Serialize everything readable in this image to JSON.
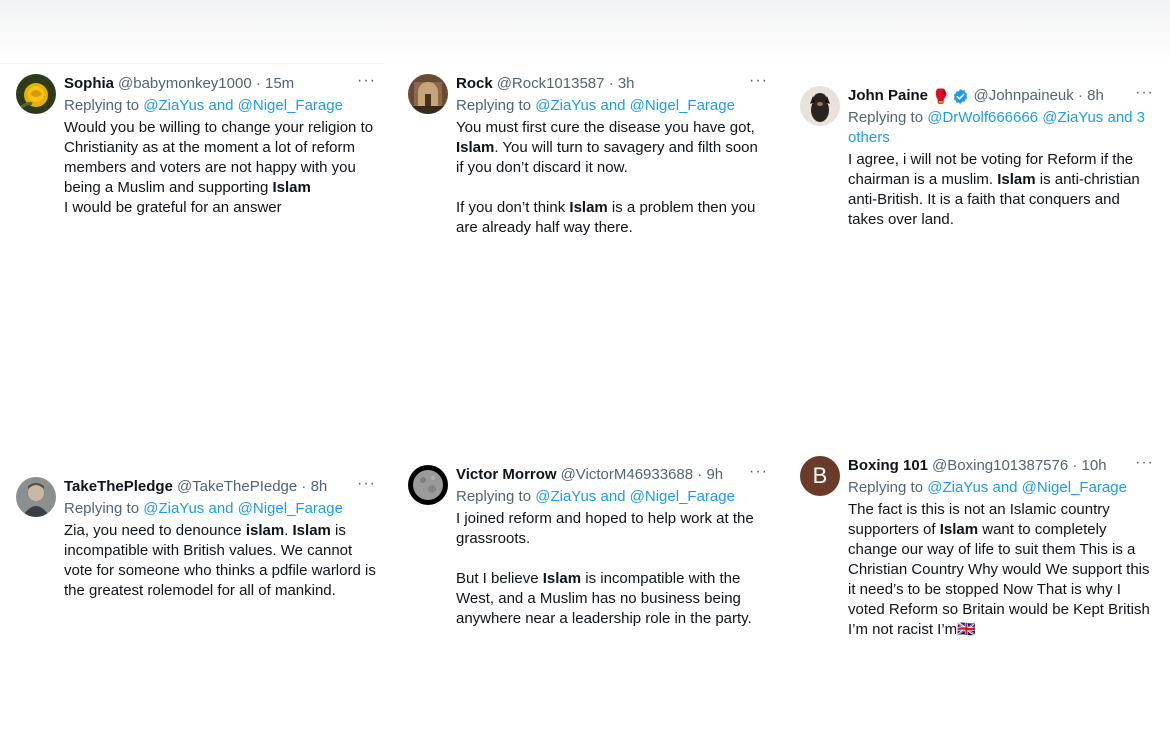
{
  "tweets": [
    {
      "name": "Sophia",
      "handle": "@babymonkey1000 · 15m",
      "reply_prefix": "Replying to ",
      "reply_to": "@ZiaYus and @Nigel_Farage",
      "text": "Would you be willing to change your religion to Christianity as at the moment a lot of reform members and voters are not happy with you being a Muslim and supporting **Islam**\nI would be grateful for an answer",
      "avatar": "yellow-rose-icon"
    },
    {
      "name": "Rock",
      "handle": "@Rock1013587 · 3h",
      "reply_prefix": "Replying to ",
      "reply_to": "@ZiaYus and @Nigel_Farage",
      "text": "You must first cure the disease you have got, **Islam**. You will turn to savagery and filth soon if you don’t discard it now.\n\nIf you don’t think **Islam** is a problem then you are already half way there.",
      "avatar": "building-interior-icon"
    },
    {
      "name": "John Paine",
      "badge": "🥊",
      "verified": true,
      "handle": "@Johnpaineuk · 8h",
      "reply_prefix": "Replying to ",
      "reply_to": "@DrWolf666666 @ZiaYus and 3 others",
      "text": "I agree, i will not be voting for Reform if the chairman is a muslim. **Islam** is anti-christian anti-British. It is a faith that conquers and takes over land.",
      "avatar": "dog-icon"
    },
    {
      "name": "TakeThePledge",
      "handle": "@TakeThePIedge · 8h",
      "reply_prefix": "Replying to ",
      "reply_to": "@ZiaYus and @Nigel_Farage",
      "text": "Zia, you need to denounce **islam**. **Islam** is incompatible with British values. We cannot vote for someone who thinks a pdfile warlord is the greatest rolemodel for all of mankind.",
      "avatar": "portrait-icon"
    },
    {
      "name": "Victor Morrow",
      "handle": "@VictorM46933688 · 9h",
      "reply_prefix": "Replying to ",
      "reply_to": "@ZiaYus and @Nigel_Farage",
      "text": "I joined reform and hoped to help work at the grassroots.\n\nBut I believe **Islam** is incompatible with the West, and a Muslim has no business being anywhere near a leadership role in the party.",
      "avatar": "moon-icon"
    },
    {
      "name": "Boxing 101",
      "handle": "@Boxing101387576 · 10h",
      "reply_prefix": "Replying to ",
      "reply_to": "@ZiaYus and @Nigel_Farage",
      "text": "The fact is this is not an Islamic country supporters of **Islam** want to completely change our way of life to suit them This is a Christian Country Why would We support this it need’s to be stopped Now That is why I voted Reform so Britain would be Kept British I’m not racist I’m🇬🇧",
      "avatar": "letter-avatar",
      "avatar_letter": "B",
      "avatar_color": "#6b3b2a"
    }
  ],
  "more_label": "···",
  "colors": {
    "link": "#1d9bf0",
    "muted": "#536471",
    "text": "#0f1419",
    "verified": "#1d9bf0"
  }
}
